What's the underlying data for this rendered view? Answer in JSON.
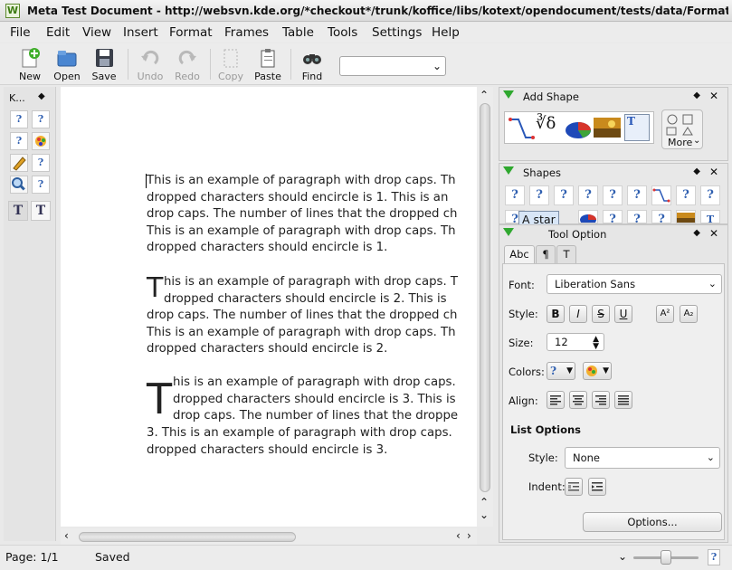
{
  "window": {
    "title": "Meta Test Document - http://websvn.kde.org/*checkout*/trunk/koffice/libs/kotext/opendocument/tests/data/FormattingProp",
    "app_icon": "W"
  },
  "menu": [
    "File",
    "Edit",
    "View",
    "Insert",
    "Format",
    "Frames",
    "Table",
    "Tools",
    "Settings",
    "Help"
  ],
  "toolbar": {
    "new": "New",
    "open": "Open",
    "save": "Save",
    "undo": "Undo",
    "redo": "Redo",
    "copy": "Copy",
    "paste": "Paste",
    "find": "Find",
    "style_combo_value": ""
  },
  "left_dock": {
    "title": "K...",
    "float": "◆"
  },
  "document": {
    "paragraphs": [
      {
        "dropcap": "",
        "lines": [
          "This is an example of paragraph with drop caps. Th",
          "dropped characters should encircle is 1. This is an",
          "drop caps. The number of lines that the dropped ch",
          "This is an example of paragraph with drop caps. Th",
          "dropped characters should encircle is 1."
        ]
      },
      {
        "dropcap": "T",
        "lines": [
          "his is an example of paragraph with drop caps. T",
          "dropped characters should encircle is 2. This is",
          "drop caps. The number of lines that the dropped ch",
          "This is an example of paragraph with drop caps. Th",
          "dropped characters should encircle is 2."
        ]
      },
      {
        "dropcap": "T",
        "lines": [
          "his is an example of paragraph with drop caps.",
          "dropped characters should encircle is 3. This is",
          "drop caps. The number of lines that the droppe",
          "3. This is an example of paragraph with drop caps.",
          "dropped characters should encircle is 3."
        ]
      }
    ]
  },
  "dock_add_shape": {
    "title": "Add Shape",
    "more_label": "More"
  },
  "dock_shapes": {
    "title": "Shapes",
    "tooltip": "A star"
  },
  "dock_tool_option": {
    "title": "Tool Option",
    "tabs": [
      "Abc",
      "¶",
      "T"
    ],
    "font_label": "Font:",
    "font_value": "Liberation Sans",
    "style_label": "Style:",
    "style_buttons": [
      "B",
      "I",
      "S",
      "U",
      "A²",
      "A₂"
    ],
    "size_label": "Size:",
    "size_value": "12",
    "colors_label": "Colors:",
    "align_label": "Align:",
    "list_options_title": "List Options",
    "list_style_label": "Style:",
    "list_style_value": "None",
    "indent_label": "Indent:",
    "options_button": "Options..."
  },
  "status": {
    "page": "Page: 1/1",
    "saved": "Saved"
  },
  "colors": {
    "accent_green": "#2fa82f",
    "link_blue": "#2f5fb0",
    "tooltip_bg": "#d8e6f7"
  }
}
